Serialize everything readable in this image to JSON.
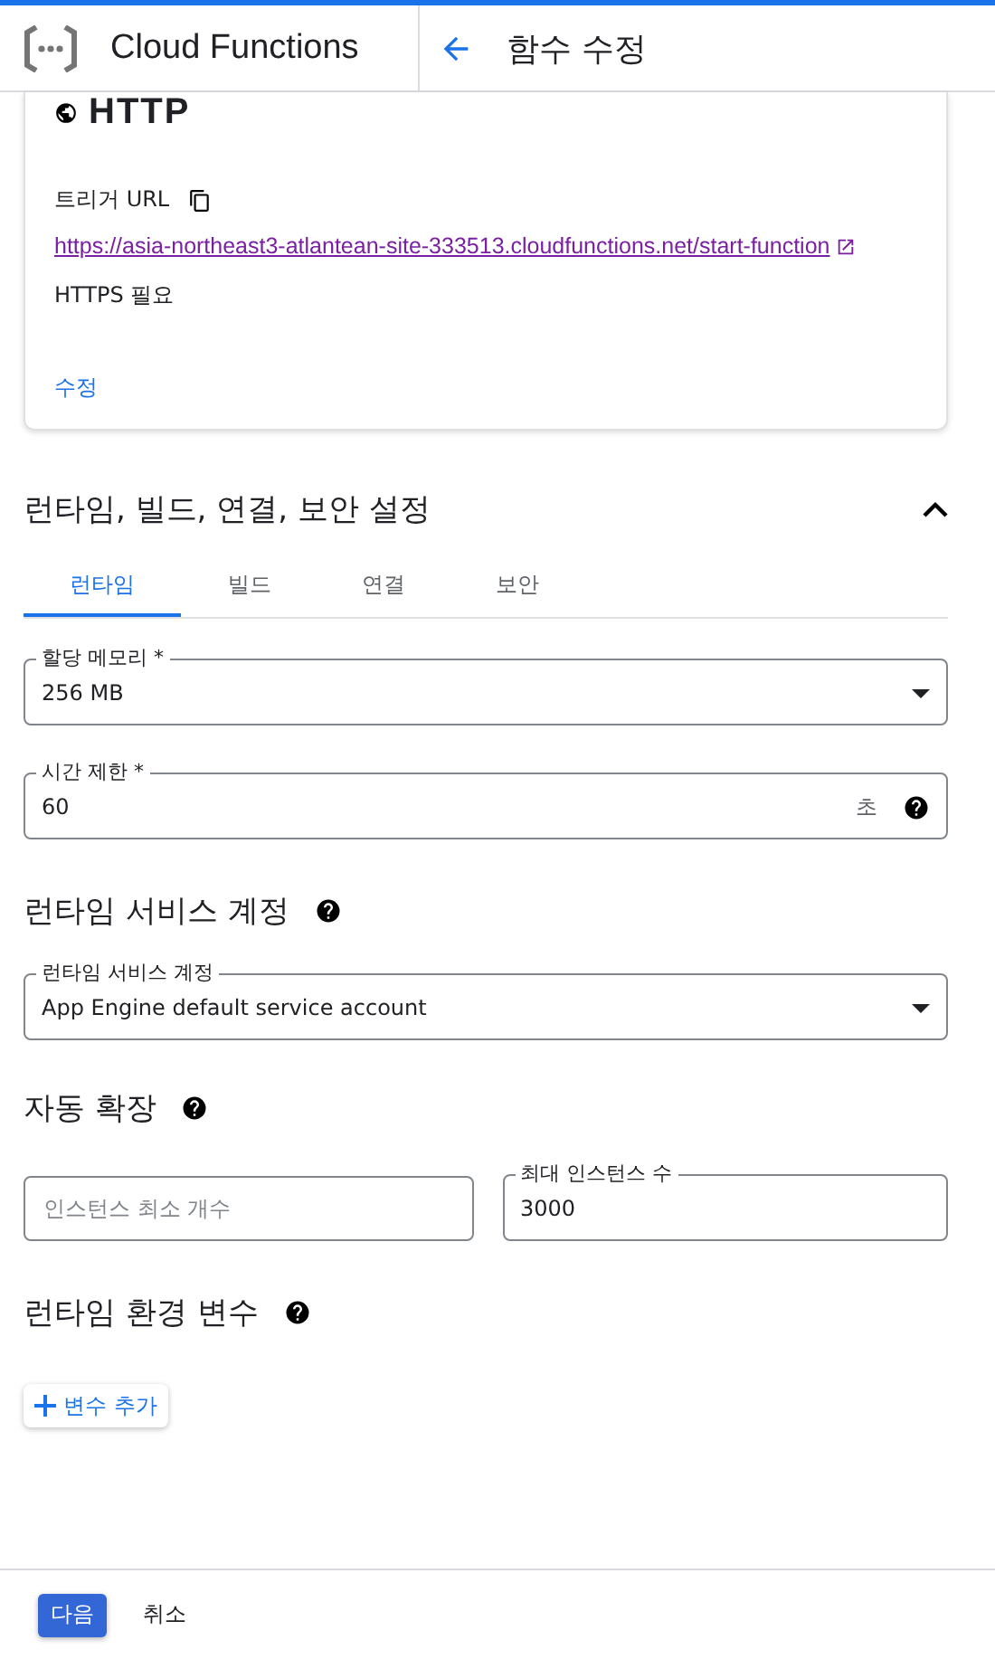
{
  "header": {
    "product": "Cloud Functions",
    "title": "함수 수정"
  },
  "trigger": {
    "type": "HTTP",
    "url_label": "트리거 URL",
    "url": "https://asia-northeast3-atlantean-site-333513.cloudfunctions.net/start-function",
    "https_note": "HTTPS 필요",
    "edit_link": "수정"
  },
  "settings": {
    "title": "런타임, 빌드, 연결, 보안 설정",
    "expanded": true,
    "tabs": [
      {
        "label": "런타임",
        "selected": true
      },
      {
        "label": "빌드",
        "selected": false
      },
      {
        "label": "연결",
        "selected": false
      },
      {
        "label": "보안",
        "selected": false
      }
    ]
  },
  "memory": {
    "label": "할당 메모리 *",
    "value": "256 MB"
  },
  "timeout": {
    "label": "시간 제한 *",
    "value": "60",
    "unit": "초"
  },
  "service_account": {
    "heading": "런타임 서비스 계정",
    "label": "런타임 서비스 계정",
    "value": "App Engine default service account"
  },
  "autoscaling": {
    "heading": "자동 확장",
    "min": {
      "placeholder": "인스턴스 최소 개수"
    },
    "max": {
      "label": "최대 인스턴스 수",
      "value": "3000"
    }
  },
  "env": {
    "heading": "런타임 환경 변수",
    "add_button": "변수 추가"
  },
  "footer": {
    "next": "다음",
    "cancel": "취소"
  }
}
